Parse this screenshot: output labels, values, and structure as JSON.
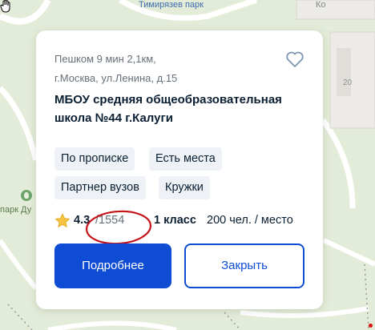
{
  "map": {
    "park_label": "Тимирязев парк",
    "building_label": "Ко",
    "house_number": "20",
    "park_label_2": "парк Ду"
  },
  "card": {
    "address_line1": "Пешком 9 мин 2,1км,",
    "address_line2": "г.Москва, ул.Ленина, д.15",
    "school_name_line1": "МБОУ средняя общеобразовательная",
    "school_name_line2": "школа №44 г.Калуги",
    "tags": [
      "По прописке",
      "Есть места",
      "Партнер вузов",
      "Кружки"
    ],
    "rating": "4.3",
    "rating_count": "1554",
    "grade": "1 класс",
    "capacity": "200 чел. / место",
    "more_button": "Подробнее",
    "close_button": "Закрыть"
  },
  "colors": {
    "accent": "#0d4cd3",
    "star": "#f5c243",
    "annotation": "#c4121a"
  }
}
